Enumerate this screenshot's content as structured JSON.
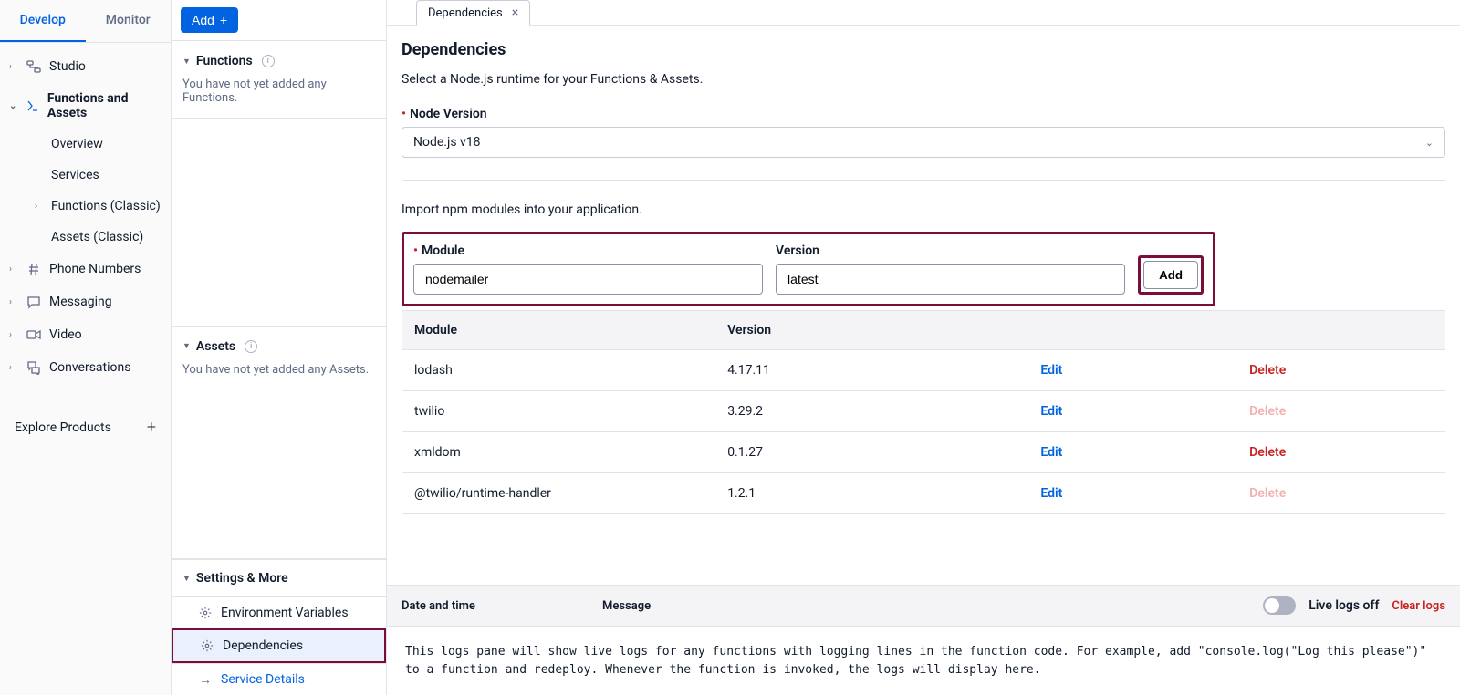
{
  "topTabs": {
    "develop": "Develop",
    "monitor": "Monitor"
  },
  "nav": {
    "studio": "Studio",
    "functionsAssets": "Functions and Assets",
    "overview": "Overview",
    "services": "Services",
    "functionsClassic": "Functions (Classic)",
    "assetsClassic": "Assets (Classic)",
    "phoneNumbers": "Phone Numbers",
    "messaging": "Messaging",
    "video": "Video",
    "conversations": "Conversations",
    "explore": "Explore Products"
  },
  "middle": {
    "addLabel": "Add",
    "functionsHeader": "Functions",
    "functionsEmpty": "You have not yet added any Functions.",
    "assetsHeader": "Assets",
    "assetsEmpty": "You have not yet added any Assets.",
    "settingsHeader": "Settings & More",
    "envVars": "Environment Variables",
    "dependencies": "Dependencies",
    "serviceDetails": "Service Details"
  },
  "tab": {
    "label": "Dependencies"
  },
  "page": {
    "title": "Dependencies",
    "desc": "Select a Node.js runtime for your Functions & Assets.",
    "nodeVersionLabel": "Node Version",
    "nodeVersionValue": "Node.js v18",
    "importDesc": "Import npm modules into your application.",
    "moduleLabel": "Module",
    "versionLabel": "Version",
    "moduleValue": "nodemailer",
    "versionValue": "latest",
    "addModuleLabel": "Add"
  },
  "table": {
    "colModule": "Module",
    "colVersion": "Version",
    "edit": "Edit",
    "delete": "Delete",
    "rows": [
      {
        "module": "lodash",
        "version": "4.17.11",
        "deletable": true
      },
      {
        "module": "twilio",
        "version": "3.29.2",
        "deletable": false
      },
      {
        "module": "xmldom",
        "version": "0.1.27",
        "deletable": true
      },
      {
        "module": "@twilio/runtime-handler",
        "version": "1.2.1",
        "deletable": false
      }
    ]
  },
  "logs": {
    "colDate": "Date and time",
    "colMessage": "Message",
    "liveLabel": "Live logs off",
    "clearLabel": "Clear logs",
    "body": "This logs pane will show live logs for any functions with logging lines in the function code. For example, add \"console.log(\"Log this please\")\" to a function and redeploy. Whenever the function is invoked, the logs will display here."
  }
}
